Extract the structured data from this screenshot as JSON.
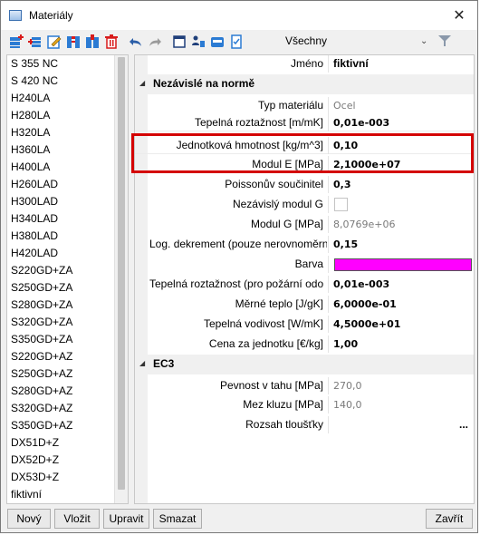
{
  "window": {
    "title": "Materiály",
    "close_glyph": "✕"
  },
  "toolbar": {
    "icons": [
      "new-material-icon",
      "insert-material-icon",
      "edit-material-icon",
      "import-icon",
      "copy-icon",
      "delete-icon",
      "undo-icon",
      "redo-icon",
      "window-icon",
      "users-icon",
      "database-icon",
      "document-check-icon"
    ],
    "filter_value": "Všechny",
    "filter_arrow": "⌄"
  },
  "materials": [
    "S 355 NC",
    "S 420 NC",
    "H240LA",
    "H280LA",
    "H320LA",
    "H360LA",
    "H400LA",
    "H260LAD",
    "H300LAD",
    "H340LAD",
    "H380LAD",
    "H420LAD",
    "S220GD+ZA",
    "S250GD+ZA",
    "S280GD+ZA",
    "S320GD+ZA",
    "S350GD+ZA",
    "S220GD+AZ",
    "S250GD+AZ",
    "S280GD+AZ",
    "S320GD+AZ",
    "S350GD+AZ",
    "DX51D+Z",
    "DX52D+Z",
    "DX53D+Z",
    "fiktivní"
  ],
  "properties": {
    "name_label": "Jméno",
    "name_value": "fiktivní",
    "section1_title": "Nezávislé na normě",
    "type_label": "Typ materiálu",
    "type_value": "Ocel",
    "thermal_exp_label": "Tepelná roztažnost [m/mK]",
    "thermal_exp_value": "0,01e-003",
    "unit_mass_label": "Jednotková hmotnost [kg/m^3]",
    "unit_mass_value": "0,10",
    "modulus_e_label": "Modul E [MPa]",
    "modulus_e_value": "2,1000e+07",
    "poisson_label": "Poissonův součinitel",
    "poisson_value": "0,3",
    "indep_g_label": "Nezávislý modul G",
    "modulus_g_label": "Modul G [MPa]",
    "modulus_g_value": "8,0769e+06",
    "log_decrement_label": "Log. dekrement (pouze nerovnoměrn",
    "log_decrement_value": "0,15",
    "color_label": "Barva",
    "color_value": "#ff00ff",
    "fire_thermal_exp_label": "Tepelná roztažnost (pro požární odo",
    "fire_thermal_exp_value": "0,01e-003",
    "specific_heat_label": "Měrné teplo [J/gK]",
    "specific_heat_value": "6,0000e-01",
    "conductivity_label": "Tepelná vodivost [W/mK]",
    "conductivity_value": "4,5000e+01",
    "unit_price_label": "Cena za jednotku [€/kg]",
    "unit_price_value": "1,00",
    "section2_title": "EC3",
    "tensile_label": "Pevnost v tahu [MPa]",
    "tensile_value": "270,0",
    "yield_label": "Mez kluzu [MPa]",
    "yield_value": "140,0",
    "thickness_label": "Rozsah tloušťky",
    "thickness_button": "..."
  },
  "buttons": {
    "new": "Nový",
    "insert": "Vložit",
    "edit": "Upravit",
    "delete": "Smazat",
    "close": "Zavřít"
  }
}
